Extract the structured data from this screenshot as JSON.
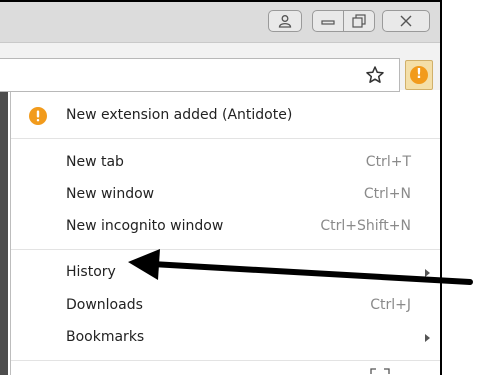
{
  "window": {
    "buttons": [
      "profile",
      "minimize",
      "restore",
      "close"
    ]
  },
  "toolbar": {
    "star_icon": "star-outline-icon",
    "menu_icon": "warning-exclamation-icon",
    "warn_glyph": "!",
    "warn_color": "#f29b1c"
  },
  "menu": {
    "notice": {
      "label": "New extension added (Antidote)"
    },
    "items": [
      {
        "label": "New tab",
        "shortcut": "Ctrl+T"
      },
      {
        "label": "New window",
        "shortcut": "Ctrl+N"
      },
      {
        "label": "New incognito window",
        "shortcut": "Ctrl+Shift+N"
      },
      {
        "label": "History",
        "shortcut": ""
      },
      {
        "label": "Downloads",
        "shortcut": "Ctrl+J"
      },
      {
        "label": "Bookmarks",
        "shortcut": ""
      }
    ]
  },
  "annotation": {
    "arrow_color": "#000000",
    "points_to": "History"
  }
}
